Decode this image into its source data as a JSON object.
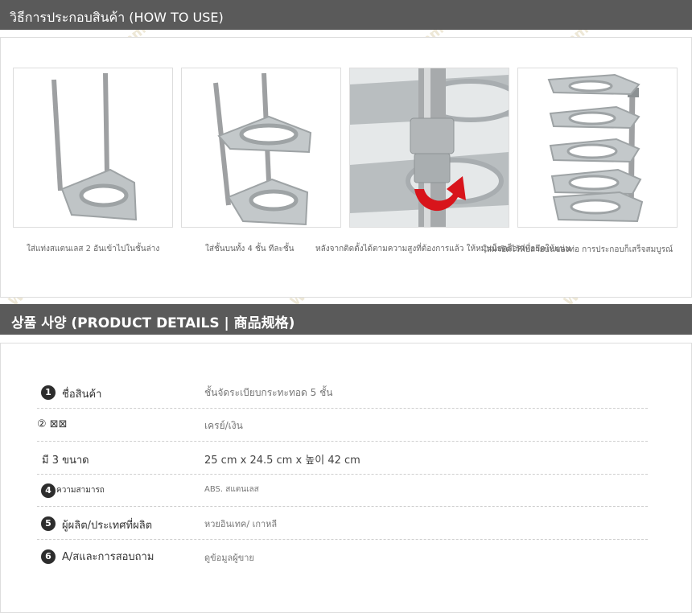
{
  "section1": {
    "title": "วิธีการประกอบสินค้า (HOW TO USE)"
  },
  "steps": [
    {
      "caption": "ใส่แท่งสแตนเลส 2 อันเข้าไปในชั้นล่าง"
    },
    {
      "caption": "ใส่ชั้นบนทั้ง 4 ชั้น ทีละชั้น"
    },
    {
      "caption": "หลังจากติดตั้งได้ตามความสูงที่ต้องการแล้ว ให้หมุนน็อตล็อคเพื่อยึดให้แน่น"
    },
    {
      "caption": "ใส่ฝาปิดไว้ที่ปลายบนของท่อ การประกอบก็เสร็จสมบูรณ์"
    }
  ],
  "section2": {
    "title": "상품 사양 (PRODUCT DETAILS | 商品规格)"
  },
  "details": [
    {
      "num": "1",
      "label": "ชื่อสินค้า",
      "value": "ชั้นจัดระเบียบกระทะทอด 5 ชั้น"
    },
    {
      "num": "",
      "label": "② ⊠⊠",
      "value": "เครย์/เงิน"
    },
    {
      "num": "",
      "label": "มี 3 ขนาด",
      "value": "25 cm x 24.5 cm x 높이 42 cm"
    },
    {
      "num": "4",
      "label": "ความสามารถ",
      "value": "ABS. สแตนเลส"
    },
    {
      "num": "5",
      "label": "ผู้ผลิต/ประเทศที่ผลิต",
      "value": "หวยอินเทค/ เกาหลี"
    },
    {
      "num": "6",
      "label": "A/สและการสอบถาม",
      "value": "ดูข้อมูลผู้ขาย"
    }
  ],
  "watermark": "Wanmii Mall",
  "colors": {
    "header_bg": "#5a5a5a",
    "rack": "#9ea3a5",
    "pole": "#c7c9cb",
    "arrow": "#d8141b"
  }
}
